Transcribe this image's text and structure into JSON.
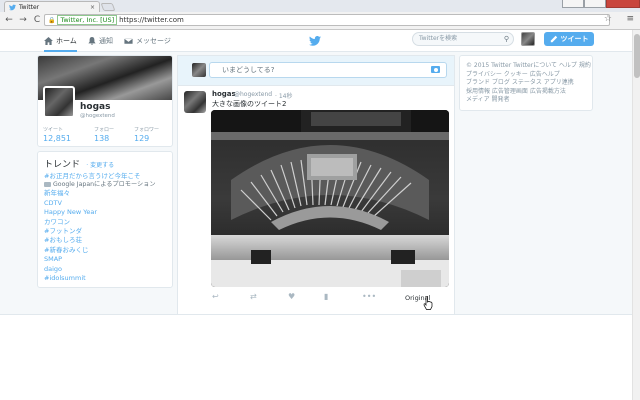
{
  "browser": {
    "tab_title": "Twitter",
    "tab_close": "×",
    "ev_badge": "Twitter, Inc. [US]",
    "url": "https://twitter.com",
    "nav_back": "←",
    "nav_forward": "→",
    "nav_reload": "C",
    "star_glyph": "☆",
    "menu_glyph": "≡"
  },
  "twitter_nav": {
    "home": "ホーム",
    "notifications": "通知",
    "messages": "メッセージ",
    "search_placeholder": "Twitterを検索",
    "tweet_button": "ツイート",
    "accent": "#55acee"
  },
  "profile": {
    "name": "hogas",
    "handle": "@hogextend",
    "stats": [
      {
        "label": "ツイート",
        "value": "12,851"
      },
      {
        "label": "フォロー",
        "value": "138"
      },
      {
        "label": "フォロワー",
        "value": "129"
      }
    ]
  },
  "trends": {
    "title": "トレンド",
    "change": "· 変更する",
    "items": [
      "#お正月だから言うけど今年こそ"
    ],
    "promo": "Google Japanによるプロモーション",
    "items2": [
      "新年福々",
      "CDTV",
      "Happy New Year",
      "カワコン",
      "#フットンダ",
      "#おもしろ荘",
      "#新春おみくじ",
      "SMAP",
      "daigo",
      "#idolsummit"
    ]
  },
  "compose": {
    "placeholder": "いまどうしてる?"
  },
  "tweet": {
    "name": "hogas",
    "handle": "@hogextend",
    "time": "· 14秒",
    "text": "大きな画像のツイート2",
    "actions": {
      "reply": "↩",
      "retweet": "⇄",
      "like": "♥",
      "analytics": "▮",
      "more": "•••"
    },
    "original_label": "Original"
  },
  "footer": {
    "lines": [
      "© 2015 Twitter  Twitterについて  ヘルプ  規約",
      "プライバシー  クッキー  広告ヘルプ",
      "ブランド  ブログ  ステータス  アプリ連携",
      "採用情報  広告管理画面  広告掲載方法",
      "メディア  開発者"
    ]
  }
}
